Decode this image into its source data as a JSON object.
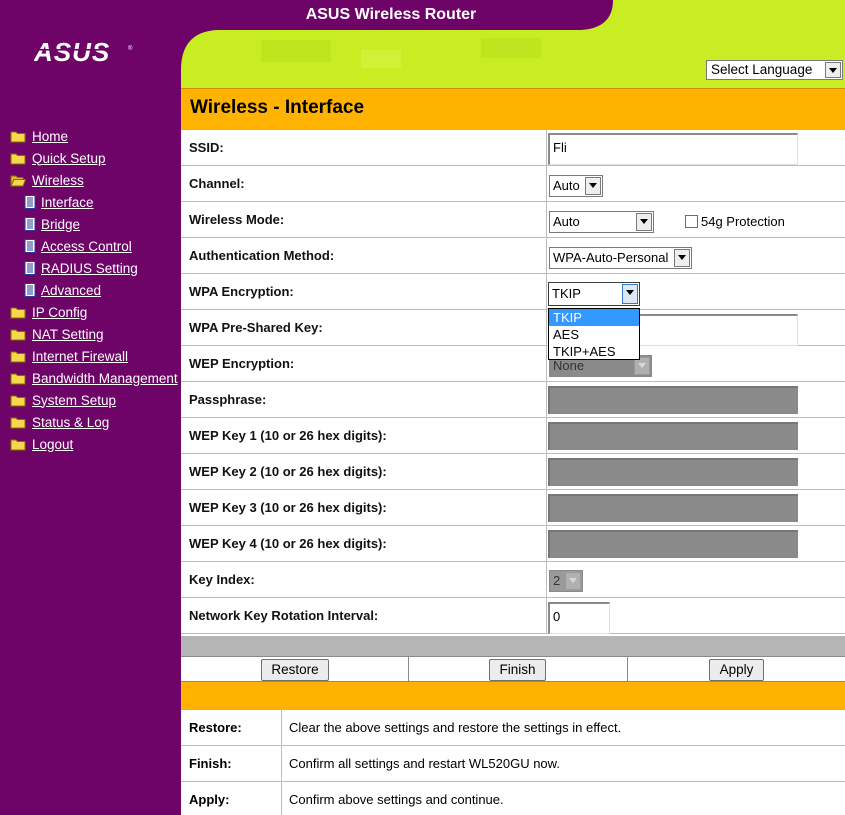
{
  "app": {
    "title": "ASUS Wireless Router",
    "logo_text": "ASUS"
  },
  "language": {
    "selected": "Select Language"
  },
  "sidebar": {
    "items": [
      {
        "label": "Home",
        "icon": "folder-icon"
      },
      {
        "label": "Quick Setup",
        "icon": "folder-icon"
      },
      {
        "label": "Wireless",
        "icon": "open-folder-icon"
      },
      {
        "label": "Interface",
        "icon": "page-icon"
      },
      {
        "label": "Bridge",
        "icon": "page-icon"
      },
      {
        "label": "Access Control",
        "icon": "page-icon"
      },
      {
        "label": "RADIUS Setting",
        "icon": "page-icon"
      },
      {
        "label": "Advanced",
        "icon": "page-icon"
      },
      {
        "label": "IP Config",
        "icon": "folder-icon"
      },
      {
        "label": "NAT Setting",
        "icon": "folder-icon"
      },
      {
        "label": "Internet Firewall",
        "icon": "folder-icon"
      },
      {
        "label": "Bandwidth Management",
        "icon": "folder-icon"
      },
      {
        "label": "System Setup",
        "icon": "folder-icon"
      },
      {
        "label": "Status & Log",
        "icon": "folder-icon"
      },
      {
        "label": "Logout",
        "icon": "folder-icon"
      }
    ]
  },
  "page": {
    "title": "Wireless - Interface"
  },
  "form": {
    "ssid": {
      "label": "SSID:",
      "value": "Fli"
    },
    "channel": {
      "label": "Channel:",
      "value": "Auto"
    },
    "wireless_mode": {
      "label": "Wireless Mode:",
      "value": "Auto",
      "protection_label": "54g Protection",
      "protection_checked": false
    },
    "auth_method": {
      "label": "Authentication Method:",
      "value": "WPA-Auto-Personal"
    },
    "wpa_encryption": {
      "label": "WPA Encryption:",
      "value": "TKIP",
      "options": [
        "TKIP",
        "AES",
        "TKIP+AES"
      ],
      "highlighted": "TKIP"
    },
    "wpa_psk": {
      "label": "WPA Pre-Shared Key:",
      "value": ""
    },
    "wep_encryption": {
      "label": "WEP Encryption:",
      "value": "None"
    },
    "passphrase": {
      "label": "Passphrase:"
    },
    "wep_key1": {
      "label": "WEP Key 1 (10 or 26 hex digits):"
    },
    "wep_key2": {
      "label": "WEP Key 2 (10 or 26 hex digits):"
    },
    "wep_key3": {
      "label": "WEP Key 3 (10 or 26 hex digits):"
    },
    "wep_key4": {
      "label": "WEP Key 4 (10 or 26 hex digits):"
    },
    "key_index": {
      "label": "Key Index:",
      "value": "2"
    },
    "rotation_interval": {
      "label": "Network Key Rotation Interval:",
      "value": "0"
    }
  },
  "buttons": {
    "restore": "Restore",
    "finish": "Finish",
    "apply": "Apply"
  },
  "help": [
    {
      "key": "Restore:",
      "text": "Clear the above settings and restore the settings in effect."
    },
    {
      "key": "Finish:",
      "text": "Confirm all settings and restart WL520GU now."
    },
    {
      "key": "Apply:",
      "text": "Confirm above settings and continue."
    }
  ],
  "colors": {
    "sidebar": "#6e0468",
    "header": "#c8ee23",
    "accent": "#ffb300",
    "selection": "#3399ff"
  }
}
